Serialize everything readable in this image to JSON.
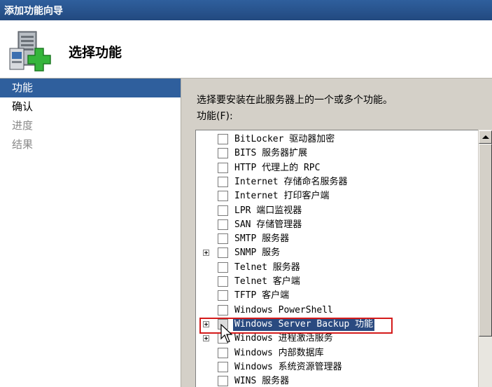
{
  "window": {
    "title": "添加功能向导"
  },
  "header": {
    "title": "选择功能",
    "icon": "server-add-icon"
  },
  "nav": {
    "items": [
      {
        "label": "功能",
        "state": "active"
      },
      {
        "label": "确认",
        "state": "normal"
      },
      {
        "label": "进度",
        "state": "disabled"
      },
      {
        "label": "结果",
        "state": "disabled"
      }
    ]
  },
  "content": {
    "instruction": "选择要安装在此服务器上的一个或多个功能。",
    "list_label": "功能(F):"
  },
  "features": [
    {
      "label": "BitLocker 驱动器加密",
      "expandable": false,
      "checked": false,
      "selected": false
    },
    {
      "label": "BITS 服务器扩展",
      "expandable": false,
      "checked": false,
      "selected": false
    },
    {
      "label": "HTTP 代理上的 RPC",
      "expandable": false,
      "checked": false,
      "selected": false
    },
    {
      "label": "Internet 存储命名服务器",
      "expandable": false,
      "checked": false,
      "selected": false
    },
    {
      "label": "Internet 打印客户端",
      "expandable": false,
      "checked": false,
      "selected": false
    },
    {
      "label": "LPR 端口监视器",
      "expandable": false,
      "checked": false,
      "selected": false
    },
    {
      "label": "SAN 存储管理器",
      "expandable": false,
      "checked": false,
      "selected": false
    },
    {
      "label": "SMTP 服务器",
      "expandable": false,
      "checked": false,
      "selected": false
    },
    {
      "label": "SNMP 服务",
      "expandable": true,
      "checked": false,
      "selected": false
    },
    {
      "label": "Telnet 服务器",
      "expandable": false,
      "checked": false,
      "selected": false
    },
    {
      "label": "Telnet 客户端",
      "expandable": false,
      "checked": false,
      "selected": false
    },
    {
      "label": "TFTP 客户端",
      "expandable": false,
      "checked": false,
      "selected": false
    },
    {
      "label": "Windows PowerShell",
      "expandable": false,
      "checked": false,
      "selected": false
    },
    {
      "label": "Windows Server Backup 功能",
      "expandable": true,
      "checked": false,
      "selected": true
    },
    {
      "label": "Windows 进程激活服务",
      "expandable": true,
      "checked": false,
      "selected": false
    },
    {
      "label": "Windows 内部数据库",
      "expandable": false,
      "checked": false,
      "selected": false
    },
    {
      "label": "Windows 系统资源管理器",
      "expandable": false,
      "checked": false,
      "selected": false
    },
    {
      "label": "WINS 服务器",
      "expandable": false,
      "checked": false,
      "selected": false
    }
  ],
  "colors": {
    "title_bar": "#2f5f9d",
    "selection": "#2a4a80",
    "highlight_box": "#d41b1b"
  }
}
